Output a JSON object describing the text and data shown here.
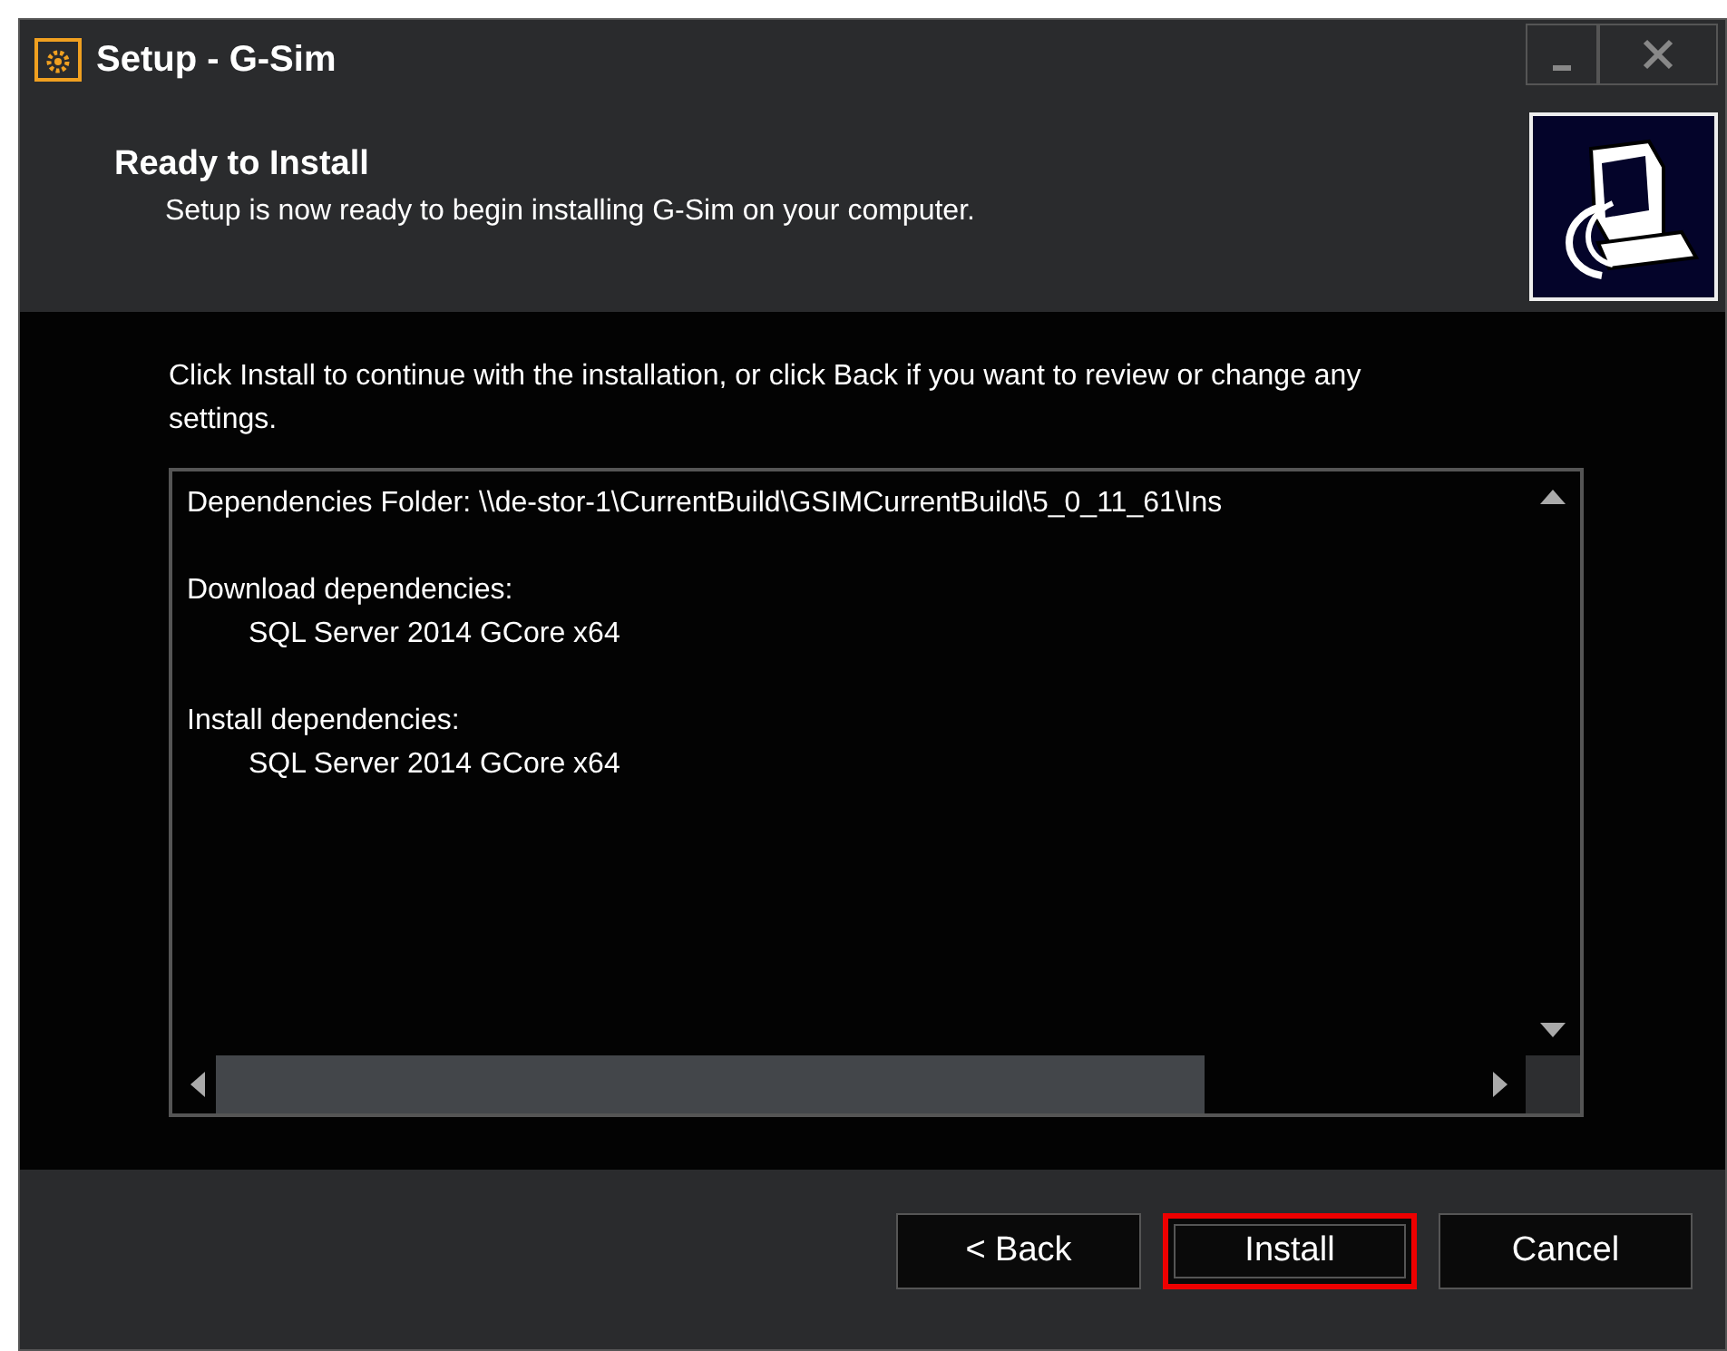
{
  "window": {
    "title": "Setup - G-Sim"
  },
  "header": {
    "title": "Ready to Install",
    "subtitle": "Setup is now ready to begin installing G-Sim on your computer."
  },
  "instructions": "Click Install to continue with the installation, or click Back if you want to review or change any settings.",
  "memo": {
    "lines": [
      {
        "kind": "heading",
        "text": "Dependencies Folder: \\\\de-stor-1\\CurrentBuild\\GSIMCurrentBuild\\5_0_11_61\\Ins"
      },
      {
        "kind": "blank"
      },
      {
        "kind": "heading",
        "text": "Download dependencies:"
      },
      {
        "kind": "item",
        "text": "SQL Server 2014 GCore x64"
      },
      {
        "kind": "blank"
      },
      {
        "kind": "heading",
        "text": "Install dependencies:"
      },
      {
        "kind": "item",
        "text": "SQL Server 2014 GCore x64"
      }
    ]
  },
  "buttons": [
    {
      "label": "< Back",
      "highlighted": false
    },
    {
      "label": "Install",
      "highlighted": true
    },
    {
      "label": "Cancel",
      "highlighted": false
    }
  ]
}
